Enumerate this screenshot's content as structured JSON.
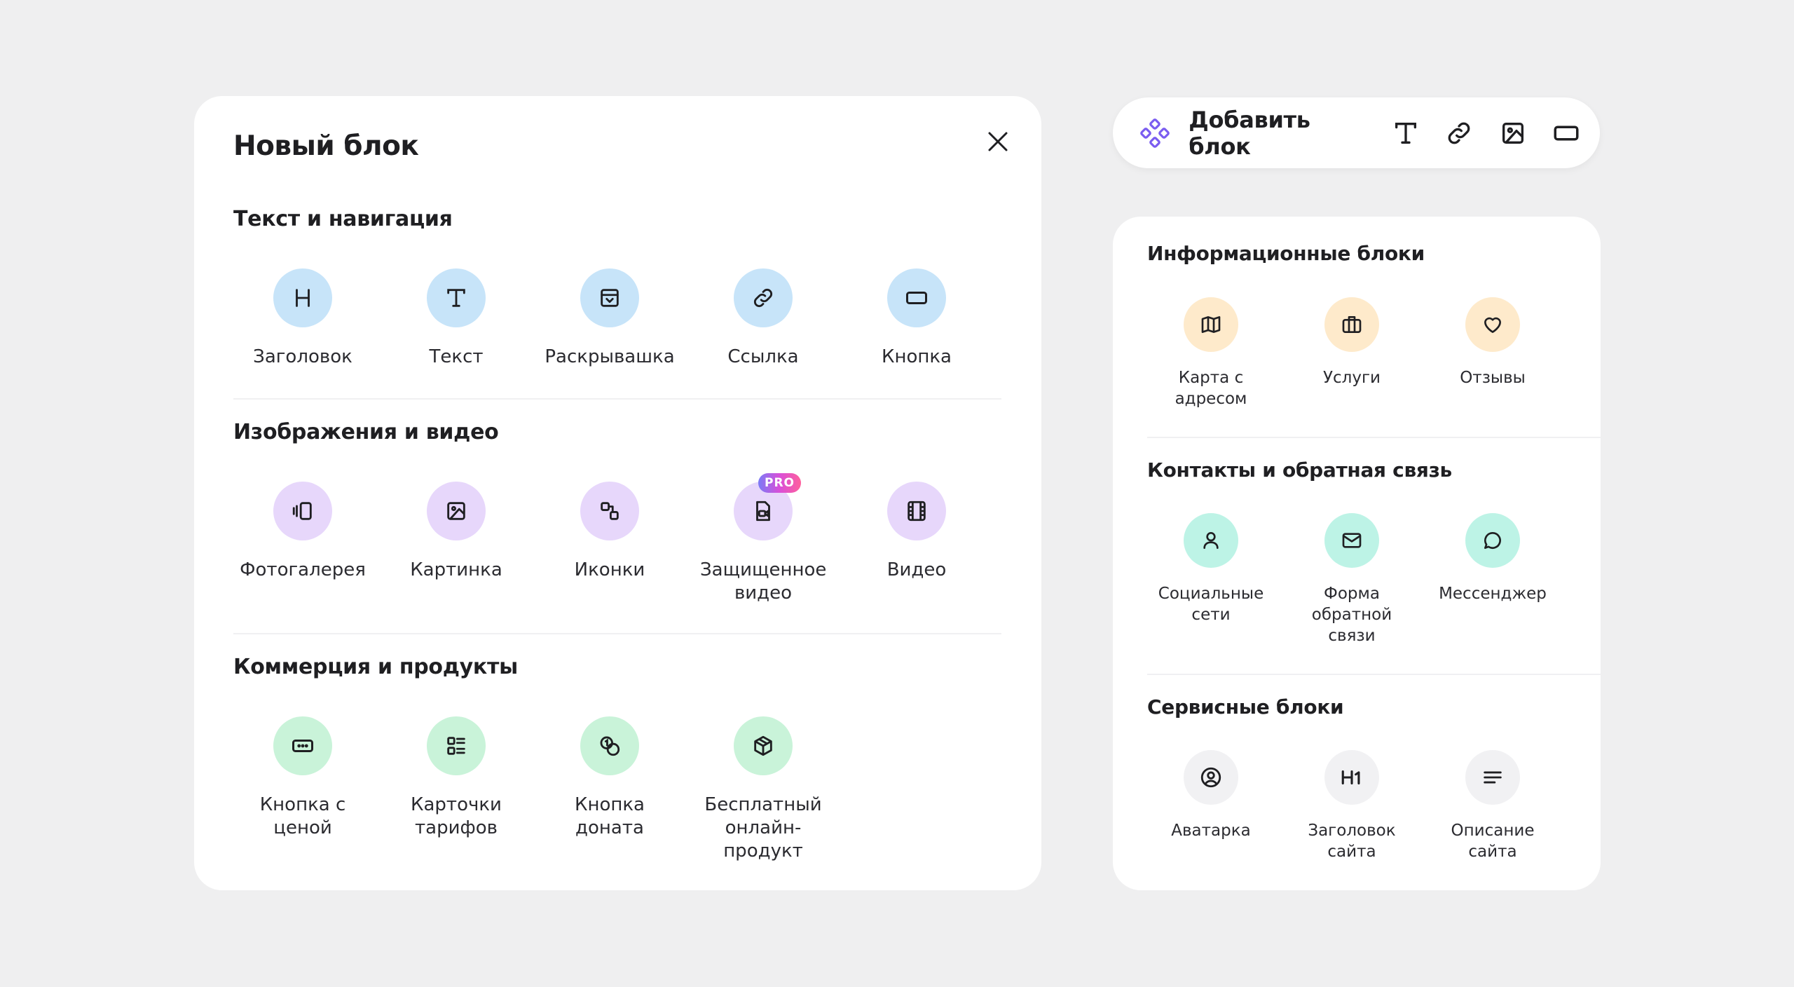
{
  "modal": {
    "title": "Новый блок",
    "sections": [
      {
        "title": "Текст и навигация",
        "items": [
          {
            "label": "Заголовок",
            "icon": "heading-icon"
          },
          {
            "label": "Текст",
            "icon": "text-icon"
          },
          {
            "label": "Раскрывашка",
            "icon": "accordion-icon"
          },
          {
            "label": "Ссылка",
            "icon": "link-icon"
          },
          {
            "label": "Кнопка",
            "icon": "button-icon"
          }
        ]
      },
      {
        "title": "Изображения и видео",
        "items": [
          {
            "label": "Фотогалерея",
            "icon": "gallery-icon"
          },
          {
            "label": "Картинка",
            "icon": "image-icon"
          },
          {
            "label": "Иконки",
            "icon": "icons-icon"
          },
          {
            "label": "Защищенное видео",
            "icon": "protected-video-icon",
            "badge": "PRO"
          },
          {
            "label": "Видео",
            "icon": "film-icon"
          }
        ]
      },
      {
        "title": "Коммерция и продукты",
        "items": [
          {
            "label": "Кнопка с ценой",
            "icon": "price-button-icon"
          },
          {
            "label": "Карточки тарифов",
            "icon": "tariff-cards-icon"
          },
          {
            "label": "Кнопка доната",
            "icon": "coins-icon"
          },
          {
            "label": "Бесплатный онлайн-продукт",
            "icon": "package-icon"
          }
        ]
      }
    ]
  },
  "toolbar": {
    "add_label": "Добавить блок",
    "buttons": [
      "text-icon",
      "link-icon",
      "image-icon",
      "button-icon"
    ]
  },
  "side": {
    "sections": [
      {
        "title": "Информационные блоки",
        "items": [
          {
            "label": "Карта с адресом",
            "icon": "map-icon"
          },
          {
            "label": "Услуги",
            "icon": "briefcase-icon"
          },
          {
            "label": "Отзывы",
            "icon": "heart-icon"
          }
        ]
      },
      {
        "title": "Контакты и обратная связь",
        "items": [
          {
            "label": "Социальные сети",
            "icon": "user-icon"
          },
          {
            "label": "Форма обратной связи",
            "icon": "mail-icon"
          },
          {
            "label": "Мессенджер",
            "icon": "chat-icon"
          }
        ]
      },
      {
        "title": "Сервисные блоки",
        "items": [
          {
            "label": "Аватарка",
            "icon": "avatar-icon"
          },
          {
            "label": "Заголовок сайта",
            "icon": "h1-icon"
          },
          {
            "label": "Описание сайта",
            "icon": "description-icon"
          }
        ]
      }
    ]
  }
}
